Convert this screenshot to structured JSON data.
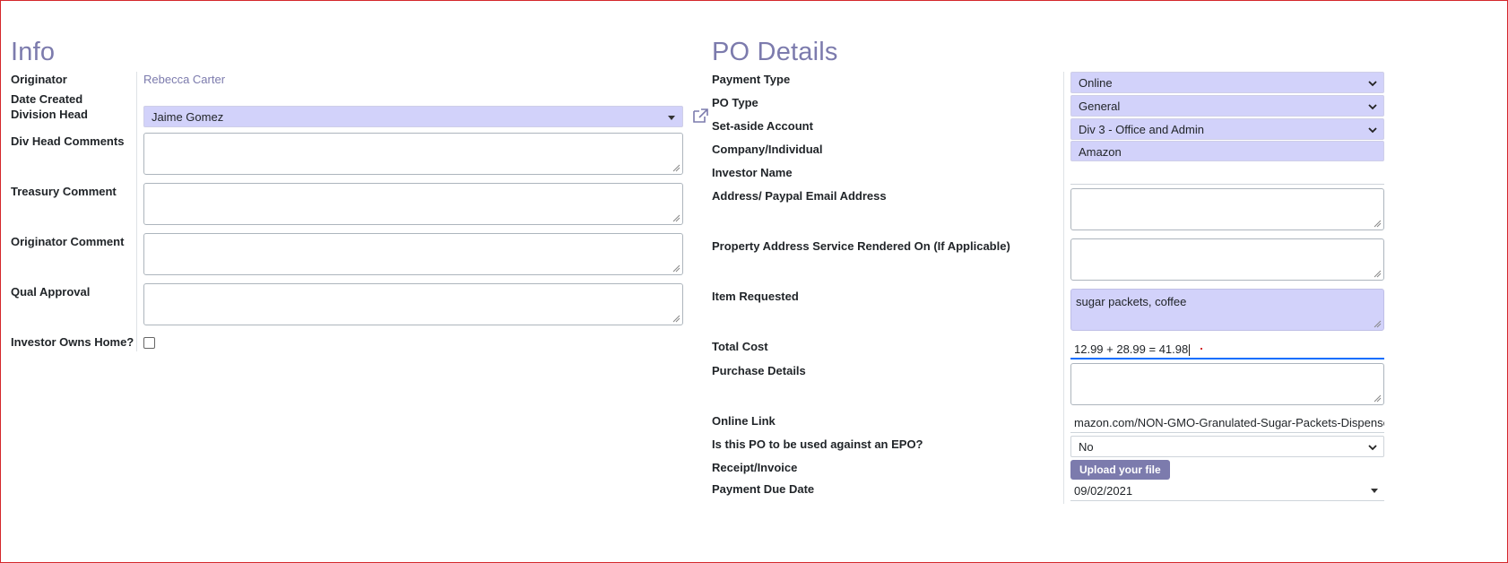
{
  "info": {
    "title": "Info",
    "originator_label": "Originator",
    "originator_value": "Rebecca Carter",
    "date_created_label": "Date Created",
    "division_head_label": "Division Head",
    "division_head_value": "Jaime Gomez",
    "div_head_comments_label": "Div Head Comments",
    "treasury_comment_label": "Treasury Comment",
    "originator_comment_label": "Originator Comment",
    "qual_approval_label": "Qual Approval",
    "investor_owns_home_label": "Investor Owns Home?"
  },
  "po": {
    "title": "PO Details",
    "payment_type_label": "Payment Type",
    "payment_type_value": "Online",
    "po_type_label": "PO Type",
    "po_type_value": "General",
    "set_aside_label": "Set-aside Account",
    "set_aside_value": "Div 3 - Office and Admin",
    "company_label": "Company/Individual",
    "company_value": "Amazon",
    "investor_name_label": "Investor Name",
    "address_label": "Address/ Paypal Email Address",
    "property_address_label": "Property Address Service Rendered On (If Applicable)",
    "item_requested_label": "Item Requested",
    "item_requested_value": "sugar packets, coffee",
    "total_cost_label": "Total Cost",
    "total_cost_value": "12.99 + 28.99 = 41.98",
    "purchase_details_label": "Purchase Details",
    "online_link_label": "Online Link",
    "online_link_value": "mazon.com/NON-GMO-Granulated-Sugar-Packets-Dispenser/dp",
    "epo_label": "Is this PO to be used against an EPO?",
    "epo_value": "No",
    "receipt_label": "Receipt/Invoice",
    "upload_label": "Upload your file",
    "due_date_label": "Payment Due Date",
    "due_date_value": "09/02/2021"
  },
  "icons": {
    "external_link": "external-link-icon",
    "chevron": "chevron-down-icon",
    "caret": "caret-down-icon"
  },
  "colors": {
    "accent": "#7c7bad",
    "field_fill": "#d2d2fa",
    "frame_border": "#d4272c",
    "focus": "#0d6efd"
  }
}
